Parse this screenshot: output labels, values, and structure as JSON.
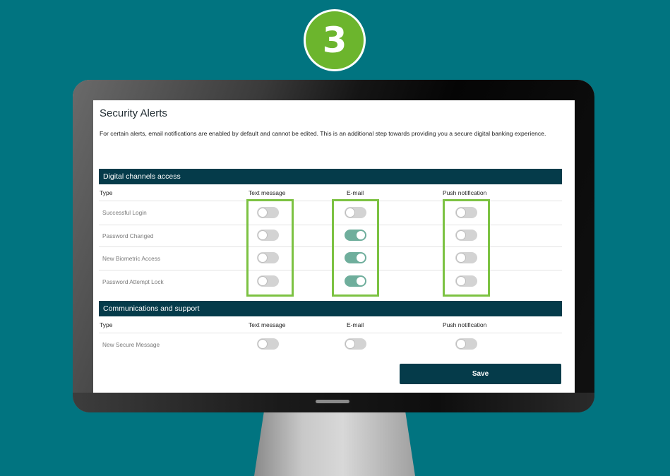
{
  "step": {
    "number": "3"
  },
  "page": {
    "title": "Security Alerts",
    "intro": "For certain alerts, email notifications are enabled by default and cannot be edited. This is an additional step towards providing you a secure digital banking experience."
  },
  "columns": {
    "type": "Type",
    "text_message": "Text message",
    "email": "E-mail",
    "push_notification": "Push notification"
  },
  "sections": [
    {
      "title": "Digital channels access",
      "rows": [
        {
          "label": "Successful Login",
          "text_message": false,
          "email": false,
          "push_notification": false
        },
        {
          "label": "Password Changed",
          "text_message": false,
          "email": true,
          "push_notification": false
        },
        {
          "label": "New Biometric Access",
          "text_message": false,
          "email": true,
          "push_notification": false
        },
        {
          "label": "Password Attempt Lock",
          "text_message": false,
          "email": true,
          "push_notification": false
        }
      ]
    },
    {
      "title": "Communications and support",
      "rows": [
        {
          "label": "New Secure Message",
          "text_message": false,
          "email": false,
          "push_notification": false
        }
      ]
    }
  ],
  "actions": {
    "save_label": "Save"
  },
  "colors": {
    "background": "#017480",
    "accent_green": "#7cc242",
    "header_bar": "#053b4a",
    "toggle_on": "#6fae9c",
    "toggle_off": "#d3d3d3"
  }
}
